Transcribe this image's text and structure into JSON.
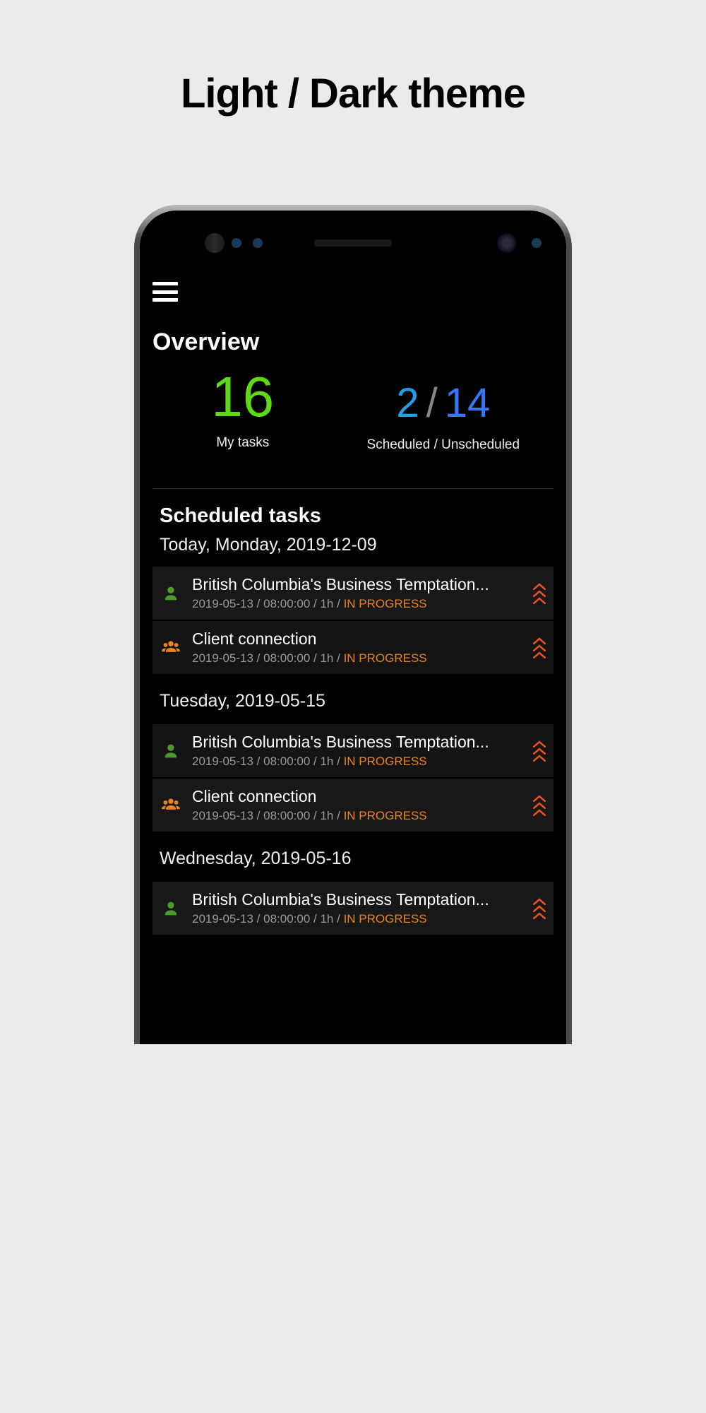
{
  "page_title": "Light / Dark theme",
  "overview": {
    "title": "Overview",
    "my_tasks_count": "16",
    "my_tasks_label": "My tasks",
    "scheduled_count": "2",
    "separator": "/",
    "unscheduled_count": "14",
    "scheduled_label": "Scheduled / Unscheduled"
  },
  "scheduled": {
    "title": "Scheduled tasks",
    "today_label": "Today, Monday, 2019-12-09"
  },
  "groups": [
    {
      "header": "Today, Monday, 2019-12-09",
      "tasks": [
        {
          "icon": "person",
          "title": "British Columbia's Business Temptation...",
          "meta_prefix": "2019-05-13 / 08:00:00 / 1h / ",
          "status": "IN PROGRESS"
        },
        {
          "icon": "group",
          "title": "Client connection",
          "meta_prefix": "2019-05-13 / 08:00:00 / 1h / ",
          "status": "IN PROGRESS"
        }
      ]
    },
    {
      "header": "Tuesday, 2019-05-15",
      "tasks": [
        {
          "icon": "person",
          "title": "British Columbia's Business Temptation...",
          "meta_prefix": "2019-05-13 / 08:00:00 / 1h / ",
          "status": "IN PROGRESS"
        },
        {
          "icon": "group",
          "title": "Client connection",
          "meta_prefix": "2019-05-13 / 08:00:00 / 1h / ",
          "status": "IN PROGRESS"
        }
      ]
    },
    {
      "header": "Wednesday, 2019-05-16",
      "tasks": [
        {
          "icon": "person",
          "title": "British Columbia's Business Temptation...",
          "meta_prefix": "2019-05-13 / 08:00:00 / 1h / ",
          "status": "IN PROGRESS"
        }
      ]
    }
  ]
}
